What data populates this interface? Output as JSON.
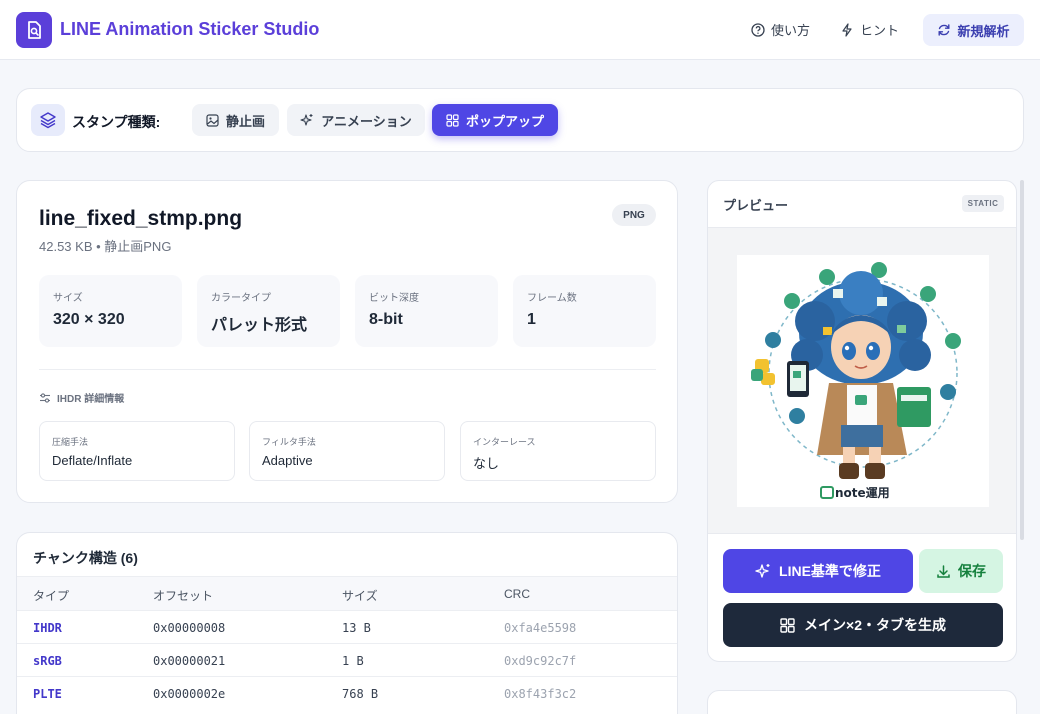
{
  "header": {
    "title": "LINE Animation Sticker Studio",
    "howto_label": "使い方",
    "hint_label": "ヒント",
    "new_label": "新規解析"
  },
  "typebar": {
    "label": "スタンプ種類:",
    "options": [
      {
        "label": "静止画",
        "icon": "image-icon"
      },
      {
        "label": "アニメーション",
        "icon": "sparkle-icon"
      },
      {
        "label": "ポップアップ",
        "icon": "grid-icon",
        "active": true
      }
    ]
  },
  "file": {
    "name": "line_fixed_stmp.png",
    "meta": "42.53 KB • 静止画PNG",
    "format_badge": "PNG",
    "stats": [
      {
        "label": "サイズ",
        "value": "320 × 320"
      },
      {
        "label": "カラータイプ",
        "value": "パレット形式"
      },
      {
        "label": "ビット深度",
        "value": "8-bit"
      },
      {
        "label": "フレーム数",
        "value": "1"
      }
    ],
    "ihdr_title": "IHDR 詳細情報",
    "ihdr": [
      {
        "label": "圧縮手法",
        "value": "Deflate/Inflate"
      },
      {
        "label": "フィルタ手法",
        "value": "Adaptive"
      },
      {
        "label": "インターレース",
        "value": "なし"
      }
    ]
  },
  "chunks": {
    "title": "チャンク構造 (6)",
    "columns": [
      "タイプ",
      "オフセット",
      "サイズ",
      "CRC"
    ],
    "rows": [
      {
        "type": "IHDR",
        "offset": "0x00000008",
        "size": "13 B",
        "crc": "0xfa4e5598"
      },
      {
        "type": "sRGB",
        "offset": "0x00000021",
        "size": "1 B",
        "crc": "0xd9c92c7f"
      },
      {
        "type": "PLTE",
        "offset": "0x0000002e",
        "size": "768 B",
        "crc": "0x8f43f3c2"
      }
    ]
  },
  "preview": {
    "title": "プレビュー",
    "badge": "STATIC",
    "sticker_caption": "note運用",
    "fix_label": "LINE基準で修正",
    "save_label": "保存",
    "generate_label": "メイン×2・タブを生成"
  },
  "colors": {
    "accent": "#4f46e5",
    "brand": "#5b3fd9",
    "dark": "#1e293b",
    "success_bg": "#d5f5e3"
  }
}
